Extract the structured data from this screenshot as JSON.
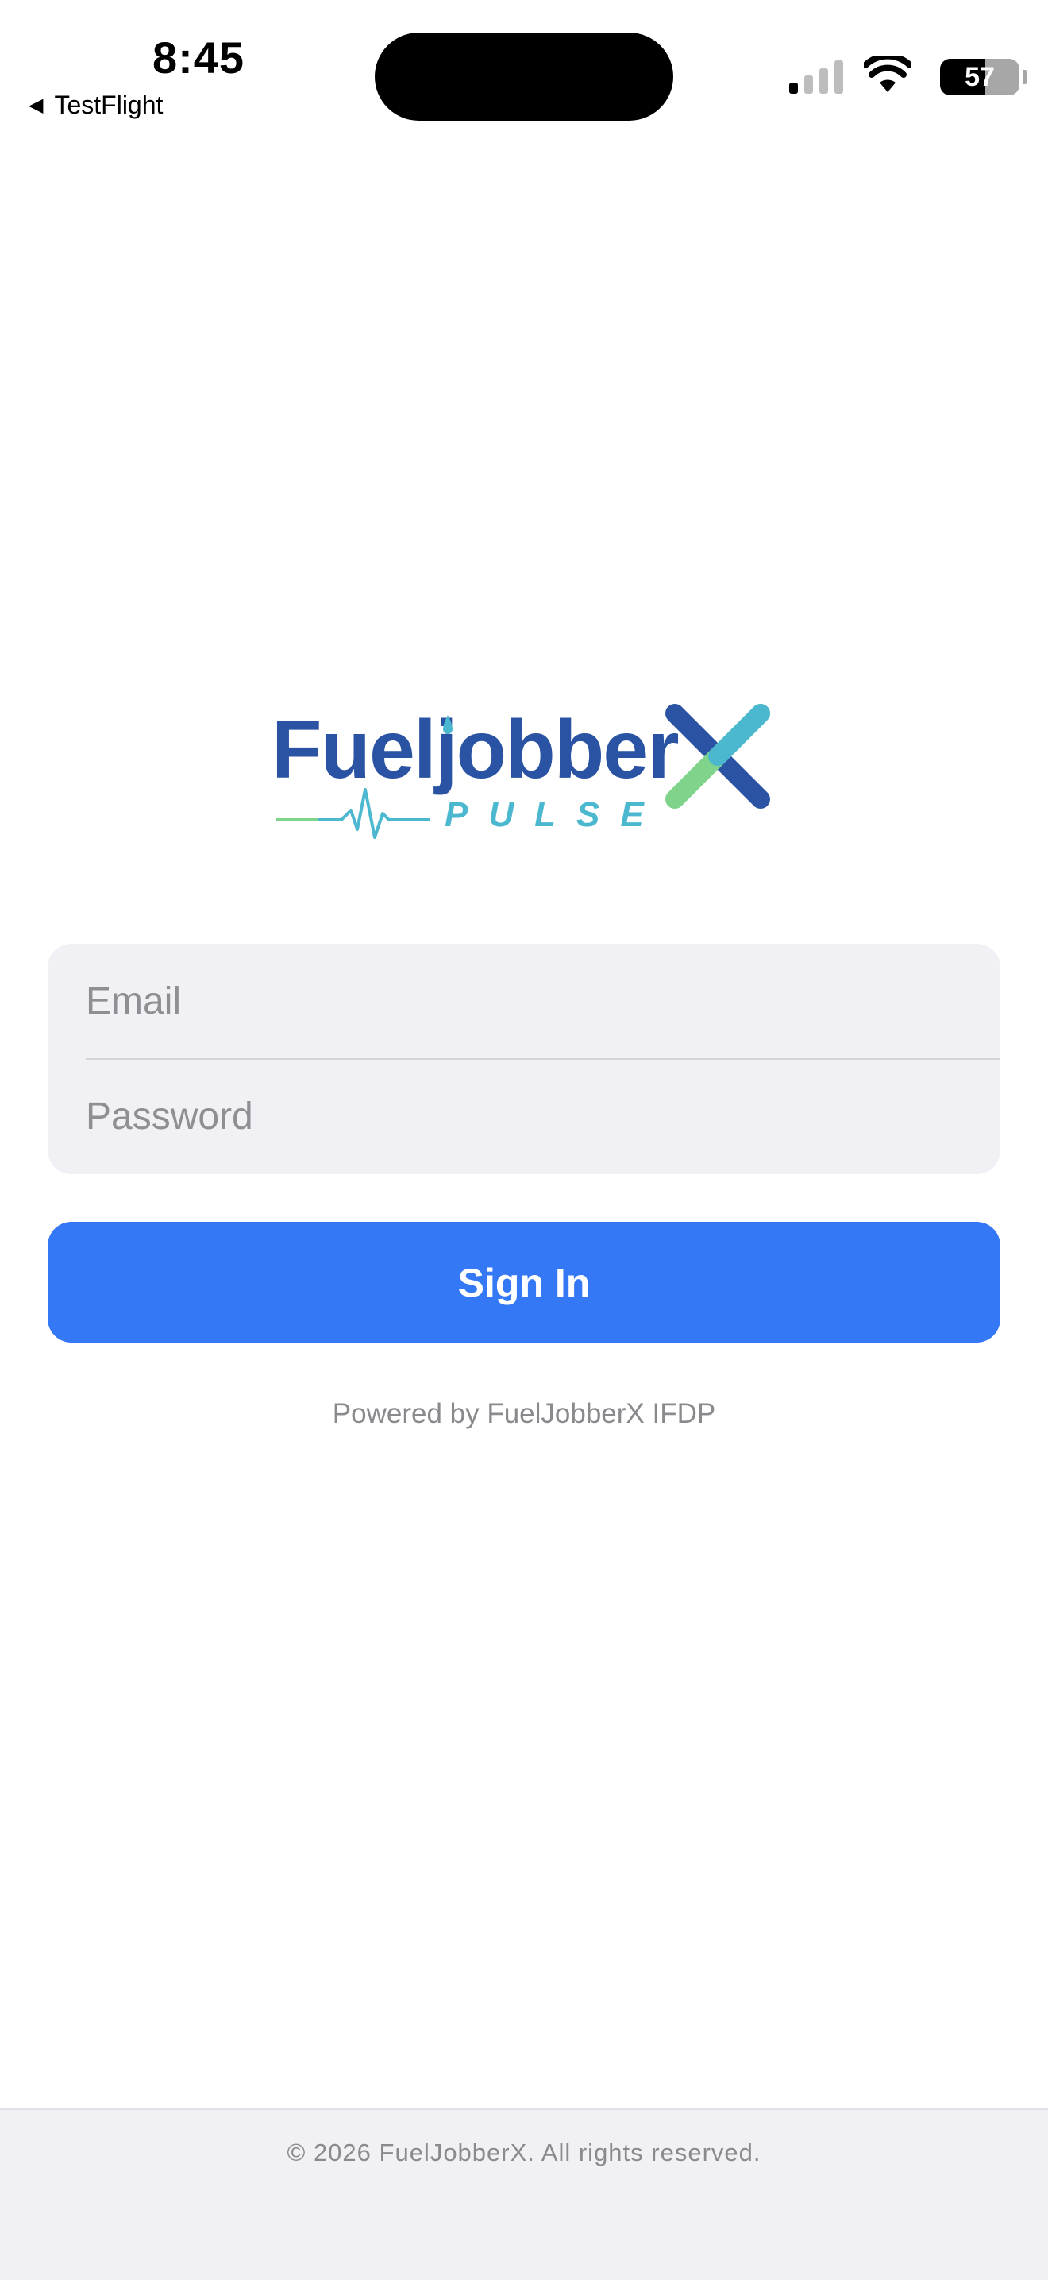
{
  "status_bar": {
    "time": "8:45",
    "back_label": "TestFlight",
    "battery_percent": "57",
    "battery_level": 0.57,
    "signal_bars_active": 1,
    "signal_bars_total": 4
  },
  "logo": {
    "wordmark": "Fueljobber",
    "subtitle": "PULSE",
    "colors": {
      "wordmark": "#2a53a3",
      "accent_blue": "#4cb8cf",
      "accent_green": "#7fd38a"
    }
  },
  "form": {
    "email_placeholder": "Email",
    "password_placeholder": "Password",
    "email_value": "",
    "password_value": ""
  },
  "signin_button": {
    "label": "Sign In",
    "color": "#3478f6"
  },
  "powered_by": "Powered by FuelJobberX IFDP",
  "footer": {
    "copyright": "© 2026 FuelJobberX. All rights reserved."
  }
}
